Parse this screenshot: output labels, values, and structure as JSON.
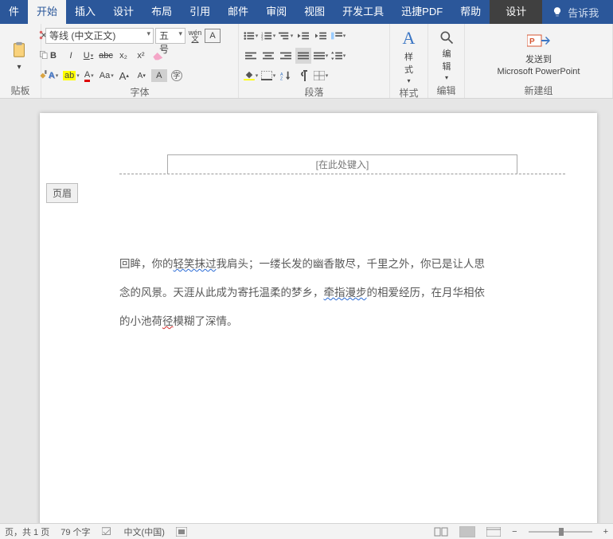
{
  "tabs": {
    "file": "件",
    "home": "开始",
    "insert": "插入",
    "design": "设计",
    "layout": "布局",
    "references": "引用",
    "mail": "邮件",
    "review": "审阅",
    "view": "视图",
    "dev": "开发工具",
    "xunjie": "迅捷PDF",
    "help": "帮助",
    "ctx": "设计",
    "tell": "告诉我"
  },
  "font": {
    "family": "等线 (中文正文)",
    "size": "五号",
    "pinyin": "wén",
    "enclose": "A",
    "bold": "B",
    "italic": "I",
    "underline": "U",
    "strike": "abc",
    "sub": "x₂",
    "sup": "x²",
    "fontfx": "A",
    "hl": "ab",
    "fc": "A",
    "case": "Aa",
    "growA": "A",
    "shrinkA": "A",
    "charshade": "A",
    "label": "字体"
  },
  "para": {
    "label": "段落"
  },
  "styles": {
    "big": "A",
    "label": "样式"
  },
  "editing": {
    "label": "编辑"
  },
  "sendto": {
    "line1": "发送到",
    "line2": "Microsoft PowerPoint",
    "label": "新建组"
  },
  "clipboard": {
    "label": "贴板"
  },
  "header": {
    "placeholder": "[在此处键入]",
    "tag": "页眉"
  },
  "body": {
    "p1a": "回眸，你的",
    "p1w": "轻笑抹过",
    "p1b": "我肩头；一缕长发的幽香散尽，千里之外，你已是让人思",
    "p2a": "念的风景。天涯从此成为寄托温柔的梦乡，",
    "p2w": "牵指漫步",
    "p2b": "的相爱经历，在月华相依",
    "p3a": "的小池荷",
    "p3w": "径",
    "p3b": "模糊了深情。"
  },
  "status": {
    "page": "页，共 1 页",
    "words": "79 个字",
    "lang": "中文(中国)"
  }
}
